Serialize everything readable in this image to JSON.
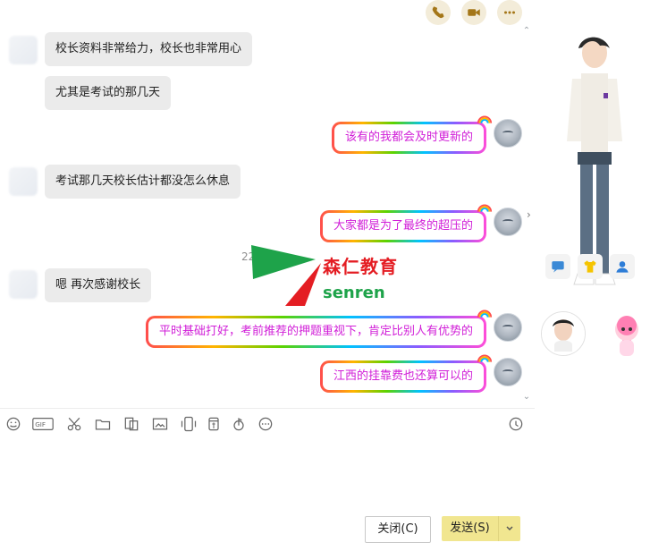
{
  "chat": {
    "messages": [
      {
        "side": "left",
        "text": "校长资料非常给力，校长也非常用心"
      },
      {
        "side": "left",
        "text": "尤其是考试的那几天"
      },
      {
        "side": "right",
        "text": "该有的我都会及时更新的"
      },
      {
        "side": "left",
        "text": "考试那几天校长估计都没怎么休息"
      },
      {
        "side": "right",
        "text": "大家都是为了最终的超压的"
      },
      {
        "side": "left",
        "text": "嗯 再次感谢校长"
      },
      {
        "side": "right",
        "text": "平时基础打好，考前推荐的押题重视下，肯定比别人有优势的"
      },
      {
        "side": "right",
        "text": "江西的挂靠费也还算可以的"
      }
    ],
    "timestamp": "22",
    "overlay": {
      "title": "森仁教育",
      "subtitle": "senren"
    }
  },
  "toolbar": {
    "icons": [
      "emoji-icon",
      "gif-icon",
      "scissors-icon",
      "folder-icon",
      "screenshot-icon",
      "image-icon",
      "shake-icon",
      "red-packet-icon",
      "music-icon",
      "more-icon",
      "history-icon"
    ],
    "gif_label": "GIF"
  },
  "composer": {
    "close_label": "关闭(C)",
    "send_label": "发送(S)"
  },
  "colors": {
    "accent": "#f1e690",
    "bubble_left": "#ebebeb",
    "bubble_right_text": "#d11fd8",
    "overlay_red": "#e41d23",
    "overlay_green": "#1ea34a"
  }
}
